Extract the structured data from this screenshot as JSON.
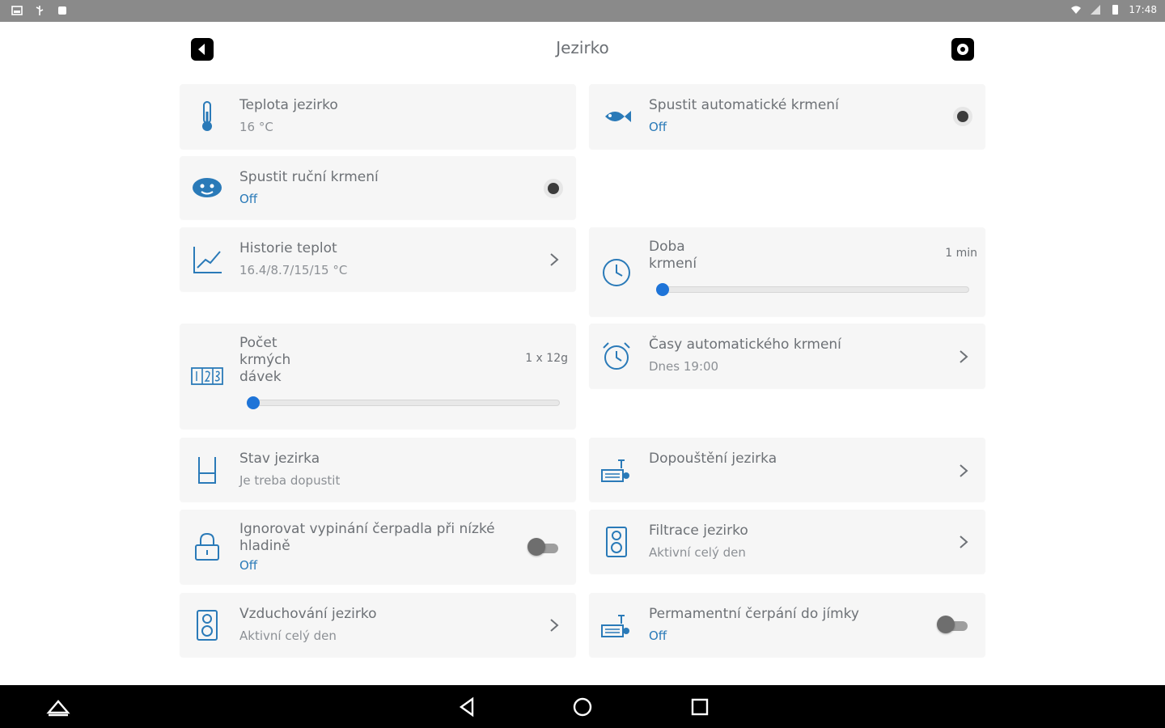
{
  "status_bar": {
    "time": "17:48"
  },
  "app_bar": {
    "title": "Jezirko"
  },
  "colors": {
    "accent": "#1e74d8",
    "icon": "#2a7ab8",
    "card": "#f6f6f6"
  },
  "cards": {
    "teplota": {
      "title": "Teplota jezirko",
      "value": "16 °C",
      "icon": "thermometer-icon"
    },
    "auto_krmeni": {
      "title": "Spustit automatické krmení",
      "value": "Off",
      "icon": "fish-icon"
    },
    "rucni_krmeni": {
      "title": "Spustit ruční krmení",
      "value": "Off",
      "icon": "feeder-icon"
    },
    "historie": {
      "title": "Historie teplot",
      "value": "16.4/8.7/15/15 °C",
      "icon": "chart-icon"
    },
    "doba_krmeni": {
      "title": "Doba krmení",
      "value": "1 min",
      "slider_fraction": 0.0,
      "icon": "clock-icon"
    },
    "pocet_davek": {
      "title": "Počet krmých dávek",
      "value": "1 x 12g",
      "slider_fraction": 0.0,
      "icon": "counter-icon"
    },
    "casy_krmeni": {
      "title": "Časy automatického krmení",
      "value": "Dnes 19:00",
      "icon": "alarm-icon"
    },
    "stav_jezirka": {
      "title": "Stav jezirka",
      "value": "Je treba dopustit",
      "icon": "water-level-icon"
    },
    "dopousteni": {
      "title": "Dopouštění jezirka",
      "icon": "tap-icon"
    },
    "ignorovat": {
      "title": "Ignorovat vypinání čerpadla při nízké hladině",
      "value": "Off",
      "icon": "lock-icon"
    },
    "filtrace": {
      "title": "Filtrace jezirko",
      "value": "Aktivní celý den",
      "icon": "speaker-icon"
    },
    "vzduchovani": {
      "title": "Vzduchování jezirko",
      "value": "Aktivní celý den",
      "icon": "speaker-icon"
    },
    "cerpani": {
      "title": "Permamentní čerpání do jímky",
      "value": "Off",
      "icon": "tap-icon"
    }
  }
}
